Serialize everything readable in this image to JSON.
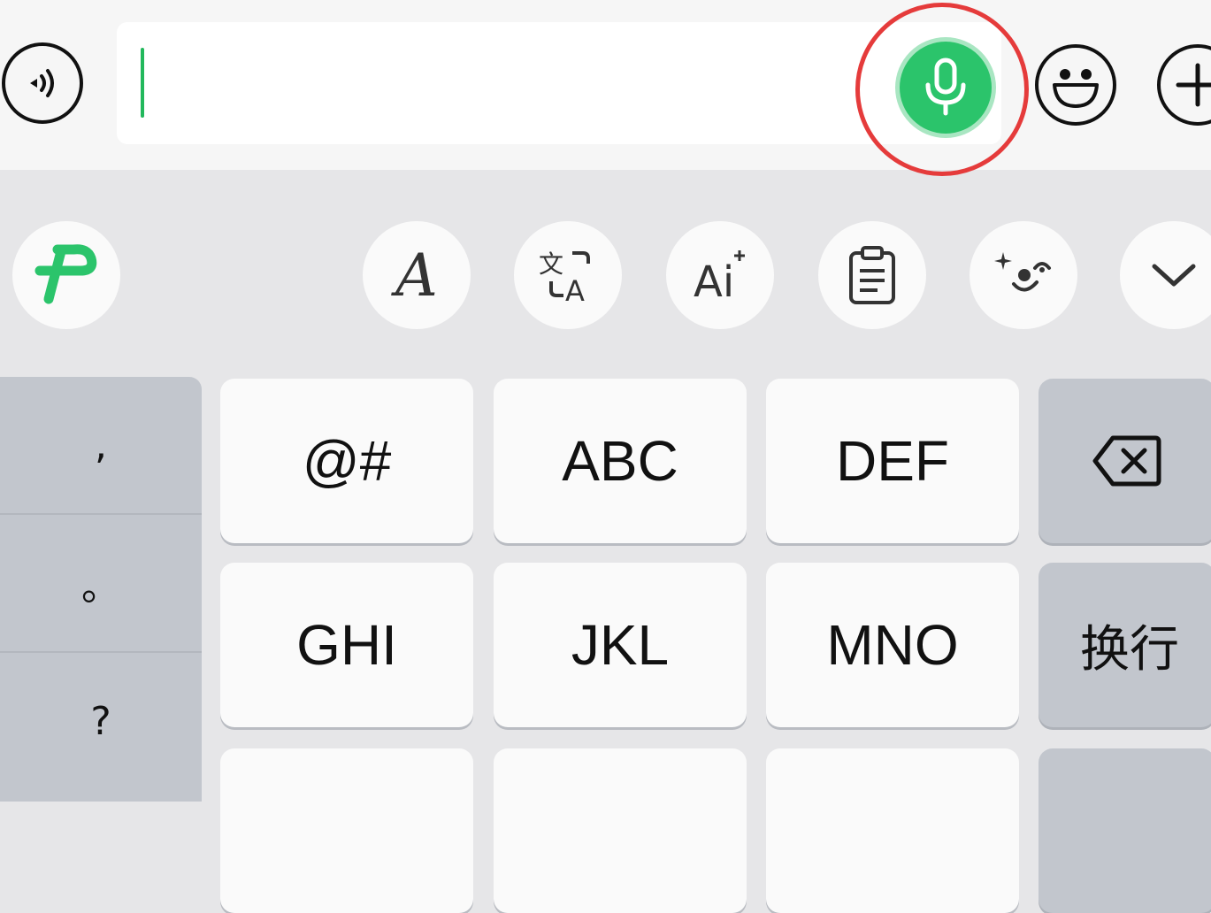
{
  "input_bar": {
    "text_value": "",
    "icons": {
      "voice_toggle": "sound-wave-icon",
      "mic": "microphone-icon",
      "emoji": "smiley-face-icon",
      "add": "plus-icon"
    },
    "accent_color": "#2bc46b",
    "highlight_color": "#e53b3b"
  },
  "toolbar": {
    "items": [
      {
        "icon": "ime-logo-icon"
      },
      {
        "icon": "font-style-icon"
      },
      {
        "icon": "translate-icon"
      },
      {
        "icon": "ai-writing-icon"
      },
      {
        "icon": "clipboard-icon"
      },
      {
        "icon": "sticker-face-icon"
      },
      {
        "icon": "chevron-down-icon"
      }
    ]
  },
  "keyboard": {
    "punctuation": [
      ",",
      "。",
      "?"
    ],
    "row1": [
      "@#",
      "ABC",
      "DEF"
    ],
    "row2": [
      "GHI",
      "JKL",
      "MNO"
    ],
    "backspace_icon": "backspace-icon",
    "enter_label": "换行"
  }
}
